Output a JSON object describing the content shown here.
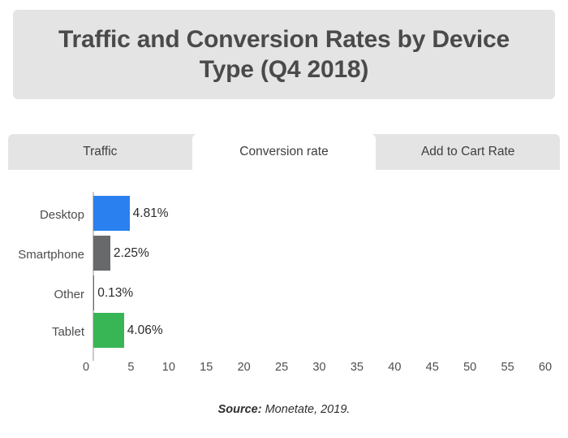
{
  "title": "Traffic and Conversion Rates by Device Type (Q4 2018)",
  "tabs": [
    {
      "label": "Traffic",
      "active": false
    },
    {
      "label": "Conversion rate",
      "active": true
    },
    {
      "label": "Add to Cart Rate",
      "active": false
    }
  ],
  "source": {
    "label": "Source:",
    "text": " Monetate, 2019."
  },
  "colors": {
    "panel_bg": "#e4e4e4",
    "page_bg": "#ffffff",
    "title_text": "#4a4a4a",
    "axis_line": "#c9c9c9",
    "desktop": "#2a80ef",
    "smartphone": "#68696b",
    "other": "#68696b",
    "tablet": "#38b555"
  },
  "chart_data": {
    "type": "bar",
    "orientation": "horizontal",
    "title": "Traffic and Conversion Rates by Device Type (Q4 2018)",
    "xlabel": "",
    "ylabel": "",
    "categories": [
      "Desktop",
      "Smartphone",
      "Other",
      "Tablet"
    ],
    "values": [
      4.81,
      2.25,
      0.13,
      4.06
    ],
    "value_labels": [
      "4.81%",
      "2.25%",
      "0.13%",
      "4.06%"
    ],
    "bar_colors": [
      "#2a80ef",
      "#68696b",
      "#68696b",
      "#38b555"
    ],
    "xlim": [
      0,
      60
    ],
    "xticks": [
      0,
      5,
      10,
      15,
      20,
      25,
      30,
      35,
      40,
      45,
      50,
      55,
      60
    ],
    "xtick_labels": [
      "0",
      "5",
      "10",
      "15",
      "20",
      "25",
      "30",
      "35",
      "40",
      "45",
      "50",
      "55",
      "60"
    ],
    "grid": false,
    "legend": "none",
    "units": "percent"
  }
}
